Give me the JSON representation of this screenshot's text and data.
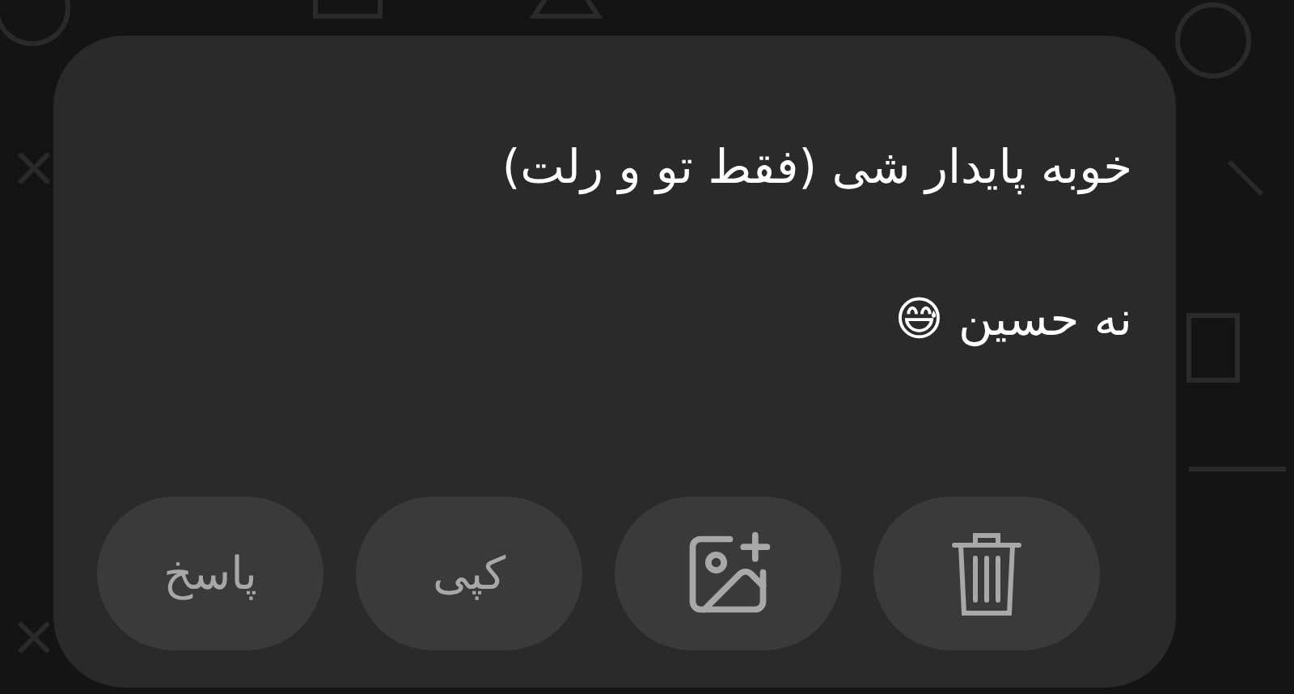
{
  "message": {
    "lines": [
      "خوبه پایدار شی (فقط تو و رلت)",
      "نه حسین 😅"
    ]
  },
  "actions": [
    {
      "kind": "delete"
    },
    {
      "kind": "add_image"
    },
    {
      "kind": "text",
      "label": "کپی"
    },
    {
      "kind": "text",
      "label": "پاسخ"
    }
  ]
}
